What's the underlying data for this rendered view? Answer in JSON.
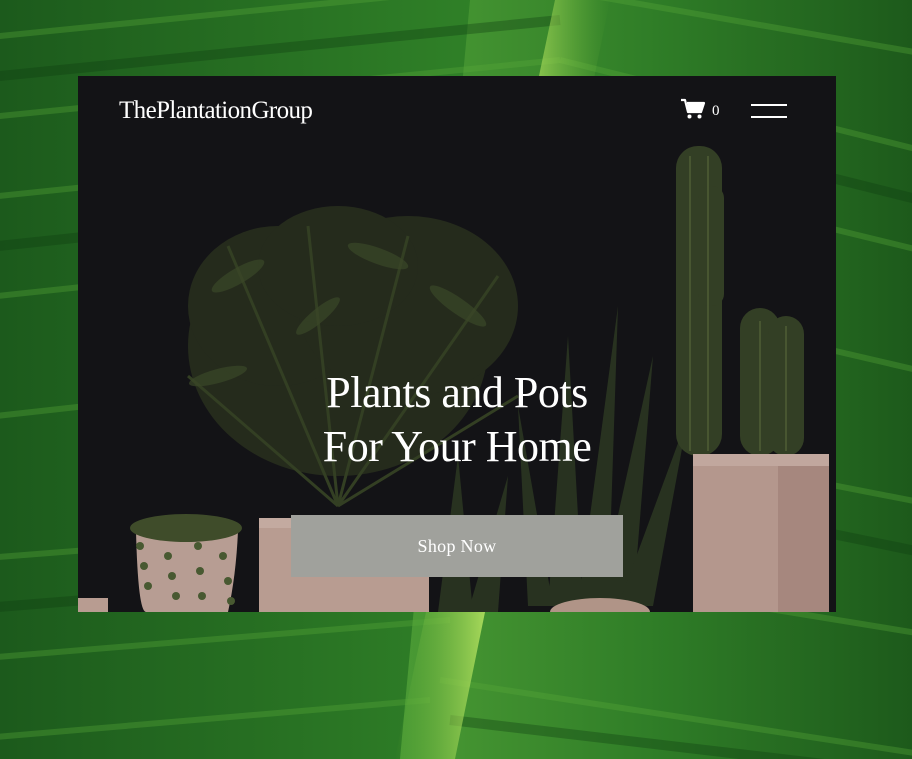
{
  "header": {
    "logo_text": "ThePlantationGroup",
    "cart_count": "0",
    "cart_icon": "shopping-cart-icon",
    "menu_icon": "hamburger-menu-icon"
  },
  "hero": {
    "heading_line_1": "Plants and Pots",
    "heading_line_2": "For Your Home",
    "cta_label": "Shop Now"
  },
  "colors": {
    "frame_background": "#17171a",
    "button_background": "#a0a19c",
    "text": "#ffffff",
    "leaf_green": "#2e7d24",
    "pot_pink": "#d9b7aa"
  }
}
